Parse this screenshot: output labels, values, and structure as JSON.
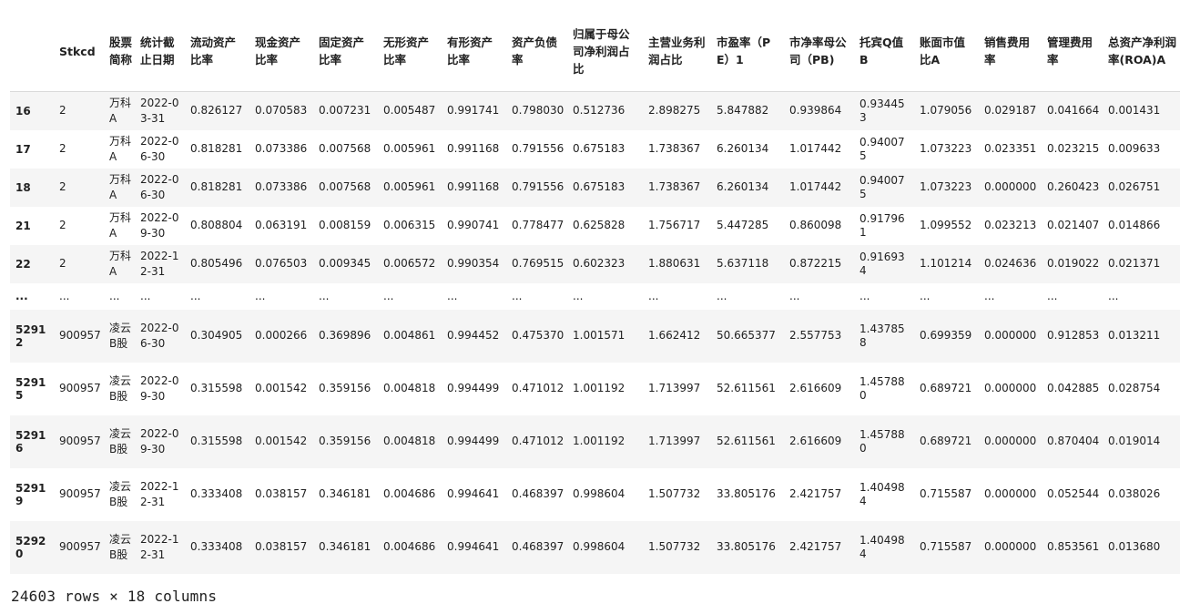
{
  "table": {
    "columns": [
      "",
      "Stkcd",
      "股票简称",
      "统计截止日期",
      "流动资产比率",
      "现金资产比率",
      "固定资产比率",
      "无形资产比率",
      "有形资产比率",
      "资产负债率",
      "归属于母公司净利润占比",
      "主营业务利润占比",
      "市盈率（PE）1",
      "市净率母公司（PB)",
      "托宾Q值B",
      "账面市值比A",
      "销售费用率",
      "管理费用率",
      "总资产净利润率(ROA)A"
    ],
    "rows": [
      {
        "idx": "16",
        "cells": [
          "2",
          "万科A",
          "2022-03-31",
          "0.826127",
          "0.070583",
          "0.007231",
          "0.005487",
          "0.991741",
          "0.798030",
          "0.512736",
          "2.898275",
          "5.847882",
          "0.939864",
          "0.934453",
          "1.079056",
          "0.029187",
          "0.041664",
          "0.001431"
        ]
      },
      {
        "idx": "17",
        "cells": [
          "2",
          "万科A",
          "2022-06-30",
          "0.818281",
          "0.073386",
          "0.007568",
          "0.005961",
          "0.991168",
          "0.791556",
          "0.675183",
          "1.738367",
          "6.260134",
          "1.017442",
          "0.940075",
          "1.073223",
          "0.023351",
          "0.023215",
          "0.009633"
        ]
      },
      {
        "idx": "18",
        "cells": [
          "2",
          "万科A",
          "2022-06-30",
          "0.818281",
          "0.073386",
          "0.007568",
          "0.005961",
          "0.991168",
          "0.791556",
          "0.675183",
          "1.738367",
          "6.260134",
          "1.017442",
          "0.940075",
          "1.073223",
          "0.000000",
          "0.260423",
          "0.026751"
        ]
      },
      {
        "idx": "21",
        "cells": [
          "2",
          "万科A",
          "2022-09-30",
          "0.808804",
          "0.063191",
          "0.008159",
          "0.006315",
          "0.990741",
          "0.778477",
          "0.625828",
          "1.756717",
          "5.447285",
          "0.860098",
          "0.917961",
          "1.099552",
          "0.023213",
          "0.021407",
          "0.014866"
        ]
      },
      {
        "idx": "22",
        "cells": [
          "2",
          "万科A",
          "2022-12-31",
          "0.805496",
          "0.076503",
          "0.009345",
          "0.006572",
          "0.990354",
          "0.769515",
          "0.602323",
          "1.880631",
          "5.637118",
          "0.872215",
          "0.916934",
          "1.101214",
          "0.024636",
          "0.019022",
          "0.021371"
        ]
      },
      {
        "idx": "...",
        "ellipsis": true,
        "cells": [
          "...",
          "...",
          "...",
          "...",
          "...",
          "...",
          "...",
          "...",
          "...",
          "...",
          "...",
          "...",
          "...",
          "...",
          "...",
          "...",
          "...",
          "..."
        ]
      },
      {
        "idx": "52912",
        "cells": [
          "900957",
          "凌云B股",
          "2022-06-30",
          "0.304905",
          "0.000266",
          "0.369896",
          "0.004861",
          "0.994452",
          "0.475370",
          "1.001571",
          "1.662412",
          "50.665377",
          "2.557753",
          "1.437858",
          "0.699359",
          "0.000000",
          "0.912853",
          "0.013211"
        ]
      },
      {
        "idx": "52915",
        "cells": [
          "900957",
          "凌云B股",
          "2022-09-30",
          "0.315598",
          "0.001542",
          "0.359156",
          "0.004818",
          "0.994499",
          "0.471012",
          "1.001192",
          "1.713997",
          "52.611561",
          "2.616609",
          "1.457880",
          "0.689721",
          "0.000000",
          "0.042885",
          "0.028754"
        ]
      },
      {
        "idx": "52916",
        "cells": [
          "900957",
          "凌云B股",
          "2022-09-30",
          "0.315598",
          "0.001542",
          "0.359156",
          "0.004818",
          "0.994499",
          "0.471012",
          "1.001192",
          "1.713997",
          "52.611561",
          "2.616609",
          "1.457880",
          "0.689721",
          "0.000000",
          "0.870404",
          "0.019014"
        ]
      },
      {
        "idx": "52919",
        "cells": [
          "900957",
          "凌云B股",
          "2022-12-31",
          "0.333408",
          "0.038157",
          "0.346181",
          "0.004686",
          "0.994641",
          "0.468397",
          "0.998604",
          "1.507732",
          "33.805176",
          "2.421757",
          "1.404984",
          "0.715587",
          "0.000000",
          "0.052544",
          "0.038026"
        ]
      },
      {
        "idx": "52920",
        "cells": [
          "900957",
          "凌云B股",
          "2022-12-31",
          "0.333408",
          "0.038157",
          "0.346181",
          "0.004686",
          "0.994641",
          "0.468397",
          "0.998604",
          "1.507732",
          "33.805176",
          "2.421757",
          "1.404984",
          "0.715587",
          "0.000000",
          "0.853561",
          "0.013680"
        ]
      }
    ]
  },
  "footer": {
    "shape_text": "24603 rows × 18 columns"
  },
  "colors": {
    "stripe": "#f5f5f5",
    "background": "#ffffff",
    "text": "#212121",
    "header_rule": "#d9d9d9"
  }
}
